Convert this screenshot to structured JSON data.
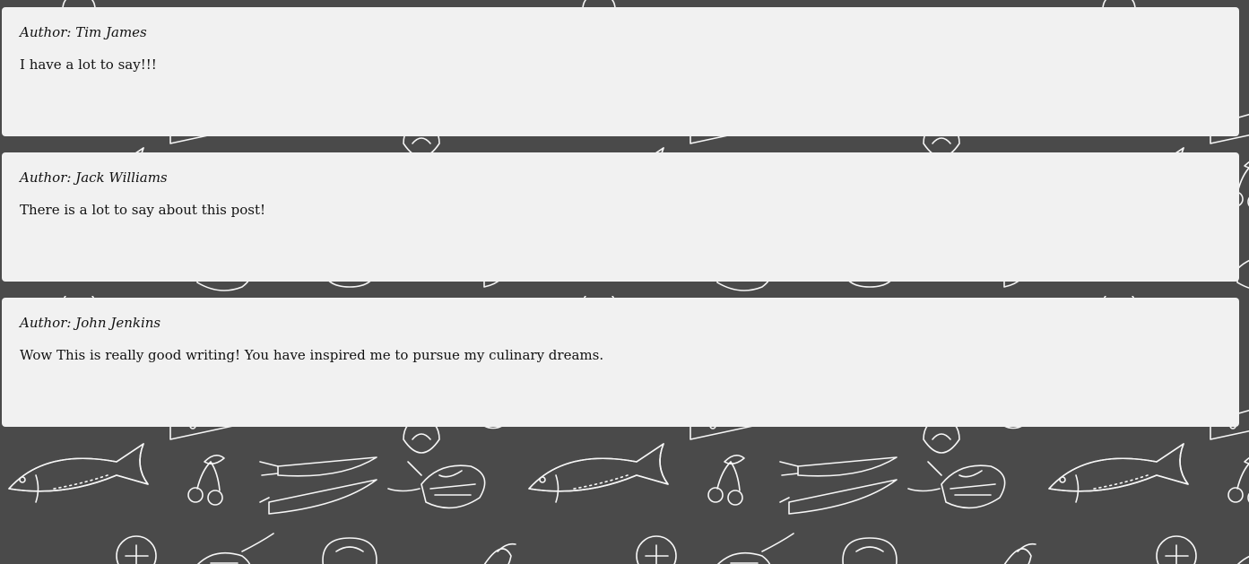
{
  "background": {
    "color": "#4a4a4a",
    "pattern": "food-doodle-pattern"
  },
  "comments": [
    {
      "author": "Author: Tim James",
      "text": "I have a lot to say!!!"
    },
    {
      "author": "Author: Jack Williams",
      "text": "There is a lot to say about this post!"
    },
    {
      "author": "Author: John Jenkins",
      "text": "Wow This is really good writing! You have inspired me to pursue my culinary dreams."
    }
  ]
}
